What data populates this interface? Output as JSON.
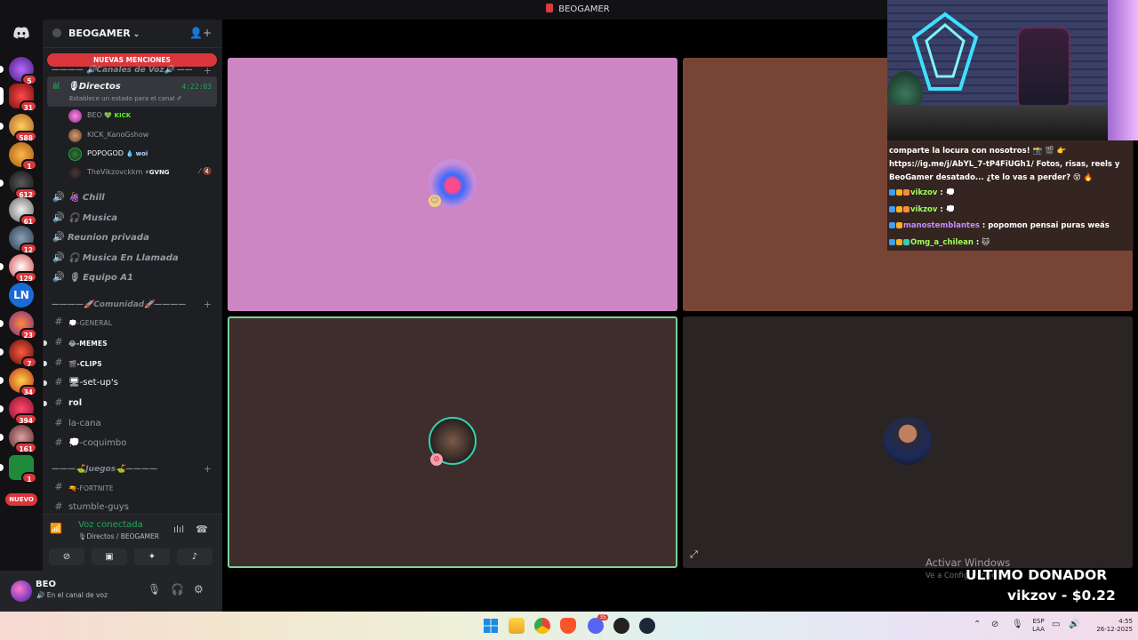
{
  "window": {
    "title": "BEOGAMER"
  },
  "server": {
    "name": "BEOGAMER",
    "mentions_pill": "NUEVAS MENCIONES",
    "nuevo_label": "NUEVO",
    "guild_badges": [
      "5",
      "31",
      "588",
      "1",
      "612",
      "61",
      "12",
      "129",
      "23",
      "7",
      "34",
      "394",
      "161",
      "1"
    ]
  },
  "categories": {
    "voice": "———— 🔊Canales de Voz🔊 ——",
    "community": "————🚀Comunidad🚀———— ",
    "games": "———⛳Juegos⛳———— "
  },
  "active_voice": {
    "name": "🎙Directos",
    "time": "4:22:03",
    "status": "Establece un estado para el canal ✐",
    "users": [
      {
        "name": "BEO",
        "tag": "💚 KICK"
      },
      {
        "name": "KICK_KanoGshow",
        "tag": ""
      },
      {
        "name": "POPOGOD",
        "tag": "💧 woi"
      },
      {
        "name": "TheVikzovckkm",
        "tag": "⚡GVNG"
      }
    ]
  },
  "voice_channels": [
    "🍇 Chill",
    "🎧 Musica",
    "Reunion privada",
    "🎧 Musica En Llamada",
    "🎙 Equipo A1"
  ],
  "text_channels": [
    {
      "name": "💭-GENERAL"
    },
    {
      "name": "😂-MEMES"
    },
    {
      "name": "🎬-CLIPS"
    },
    {
      "name": "🖥-set-up's"
    },
    {
      "name": "rol"
    },
    {
      "name": "la-cana"
    },
    {
      "name": "💭-coquimbo"
    }
  ],
  "game_channels": [
    {
      "name": "🔫-FORTNITE"
    },
    {
      "name": "stumble-guys"
    }
  ],
  "voice_panel": {
    "status": "Voz conectada",
    "location": "🎙Directos / BEOGAMER"
  },
  "user_panel": {
    "name": "BEO",
    "status": "🔊 En el canal de voz"
  },
  "chat": [
    {
      "user": "",
      "text": "comparte la locura con nosotros! 📸 🎬 👉"
    },
    {
      "user": "",
      "text": "https://ig.me/j/AbYL_7-tP4FiUGh1/ Fotos, risas, reels y"
    },
    {
      "user": "",
      "text": "BeoGamer desatado... ¿te lo vas a perder? 😵 🔥"
    },
    {
      "user": "vikzov",
      "text": " : 💭"
    },
    {
      "user": "vikzov",
      "text": " : 💭"
    },
    {
      "user": "manostemblantes",
      "text": " : popomon pensai puras weás"
    },
    {
      "user": "Omg_a_chilean",
      "text": " : 🐱"
    }
  ],
  "overlay": {
    "activate_title": "Activar Windows",
    "activate_sub": "Ve a Configuración",
    "donor_title": "ULTIMO DONADOR",
    "donor_value": "vikzov - $0.22"
  },
  "taskbar": {
    "lang_top": "ESP",
    "lang_bottom": "LAA",
    "time": "4:55",
    "date": "26-12-2025",
    "discord_badge": "35"
  }
}
